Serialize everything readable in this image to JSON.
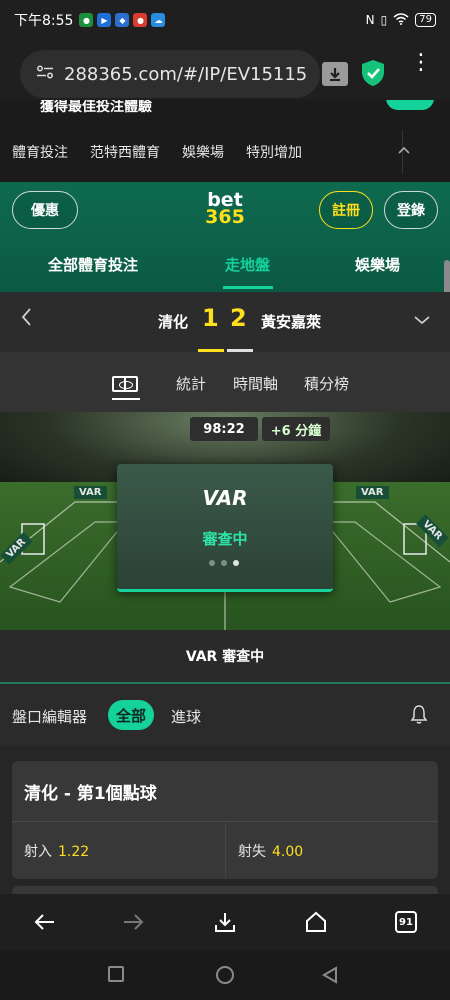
{
  "status_bar": {
    "time": "下午8:55",
    "battery": "79"
  },
  "browser": {
    "url": "288365.com/#/IP/EV15115"
  },
  "promo": {
    "text": "獲得最佳投注體驗"
  },
  "category_nav": {
    "items": [
      "體育投注",
      "范特西體育",
      "娛樂場",
      "特別增加"
    ]
  },
  "header": {
    "promo_label": "優惠",
    "logo_top": "bet",
    "logo_bottom": "365",
    "register_label": "註冊",
    "login_label": "登錄",
    "tabs": [
      {
        "label": "全部體育投注"
      },
      {
        "label": "走地盤"
      },
      {
        "label": "娛樂場"
      }
    ]
  },
  "match": {
    "home_team": "清化",
    "home_score": "1",
    "away_score": "2",
    "away_team": "黃安嘉萊"
  },
  "subtabs": {
    "items": [
      "統計",
      "時間軸",
      "積分榜"
    ]
  },
  "pitch": {
    "clock": "98:22",
    "added_time": "+6 分鐘",
    "var_title": "VAR",
    "var_status": "審查中",
    "boards": [
      "VAR",
      "VAR",
      "VAR",
      "VAR"
    ]
  },
  "var_bar": {
    "label": "VAR",
    "status": "審查中"
  },
  "market_editor": {
    "label": "盤口編輯器",
    "all_label": "全部",
    "goals_label": "進球"
  },
  "bet_card": {
    "title": "清化 - 第1個點球",
    "options": [
      {
        "label": "射入",
        "odds": "1.22"
      },
      {
        "label": "射失",
        "odds": "4.00"
      }
    ]
  },
  "browser_nav": {
    "tab_count": "91"
  },
  "colors": {
    "accent": "#14d29a",
    "yellow": "#ffdf1b",
    "header_green": "#0e6a4f"
  }
}
